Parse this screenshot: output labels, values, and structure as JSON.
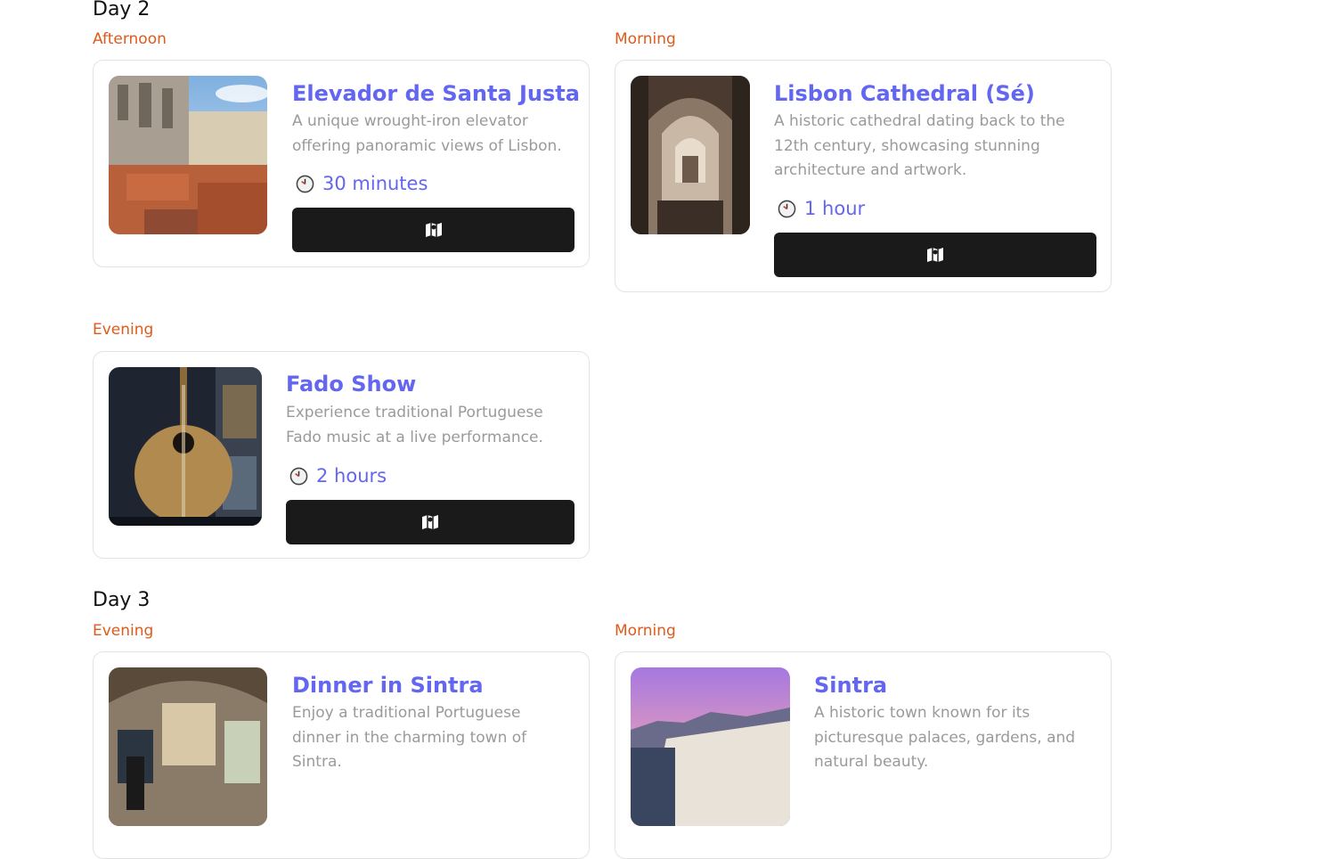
{
  "days": [
    {
      "title": "Day 2",
      "activities": [
        {
          "slot": "Afternoon",
          "title": "Elevador de Santa Justa",
          "description": "A unique wrought-iron elevator offering panoramic views of Lisbon.",
          "duration": "30 minutes",
          "map_icon": "map-icon",
          "duration_icon": "clock-icon"
        },
        {
          "slot": "Morning",
          "title": "Lisbon Cathedral (Sé)",
          "description": "A historic cathedral dating back to the 12th century, showcasing stunning architecture and artwork.",
          "duration": "1 hour",
          "map_icon": "map-icon",
          "duration_icon": "clock-icon"
        },
        {
          "slot": "Evening",
          "title": "Fado Show",
          "description": "Experience traditional Portuguese Fado music at a live performance.",
          "duration": "2 hours",
          "map_icon": "map-icon",
          "duration_icon": "clock-icon"
        }
      ]
    },
    {
      "title": "Day 3",
      "activities": [
        {
          "slot": "Evening",
          "title": "Dinner in Sintra",
          "description": "Enjoy a traditional Portuguese dinner in the charming town of Sintra.",
          "map_icon": "map-icon",
          "duration_icon": "clock-icon"
        },
        {
          "slot": "Morning",
          "title": "Sintra",
          "description": "A historic town known for its picturesque palaces, gardens, and natural beauty.",
          "map_icon": "map-icon",
          "duration_icon": "clock-icon"
        }
      ]
    }
  ],
  "colors": {
    "accent": "#6366f1",
    "slot": "#e05a1c",
    "button": "#1a1a1a",
    "description": "#9a9a9a"
  }
}
